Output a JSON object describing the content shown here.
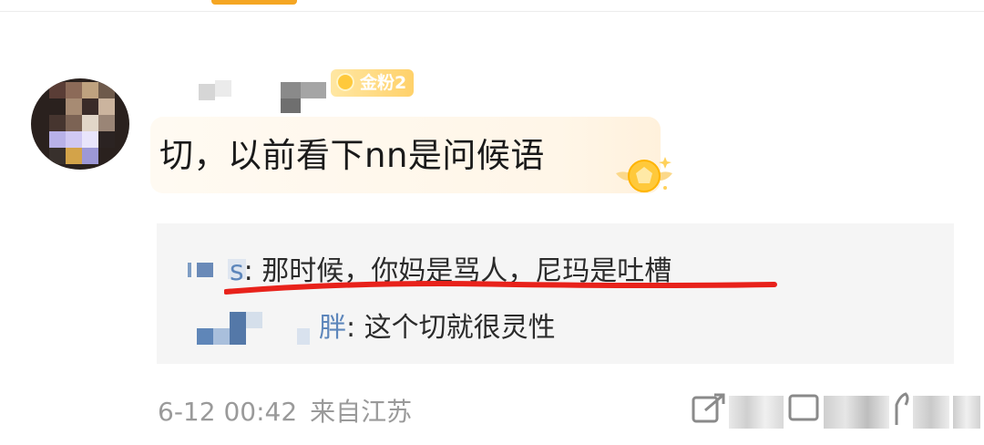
{
  "user": {
    "fan_badge": "金粉2"
  },
  "comment": {
    "text": "切，以前看下nn是问候语"
  },
  "replies": [
    {
      "name_suffix": "s",
      "separator": ": ",
      "text": "那时候，你妈是骂人，尼玛是吐槽"
    },
    {
      "name_suffix": "胖",
      "separator": ": ",
      "text": "这个切就很灵性"
    }
  ],
  "meta": {
    "time": "6-12 00:42",
    "location": "来自江苏"
  },
  "icons": {
    "share": "share-icon",
    "comment": "comment-icon",
    "like": "like-icon",
    "medal": "fan-medal-icon",
    "gem": "gem-icon"
  },
  "colors": {
    "badge": "#ffd16a",
    "reply_name": "#5d86bb",
    "highlight_underline": "#e8221b",
    "meta_text": "#9a9a9a"
  }
}
